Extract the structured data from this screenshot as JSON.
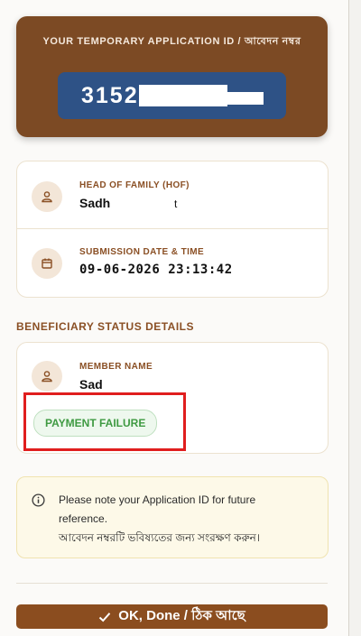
{
  "application": {
    "label": "YOUR TEMPORARY APPLICATION ID  /  আবেদন নম্বর",
    "id_visible": "3152"
  },
  "hof": {
    "label": "HEAD OF FAMILY (HOF)",
    "name_visible": "Sadh",
    "name_trailing": "t",
    "icon": "person-icon"
  },
  "submission": {
    "label": "SUBMISSION DATE & TIME",
    "value": "09-06-2026 23:13:42",
    "icon": "calendar-icon"
  },
  "section": {
    "title": "BENEFICIARY STATUS DETAILS"
  },
  "member": {
    "label": "MEMBER NAME",
    "name_visible": "Sad",
    "icon": "person-icon",
    "status": "PAYMENT FAILURE"
  },
  "note": {
    "line1": "Please note your Application ID for future",
    "line2": "reference.",
    "line3": "আবেদন নম্বরটি ভবিষ্যতের জন্য সংরক্ষণ করুন।",
    "icon": "info-icon"
  },
  "ok_button": {
    "label": "OK, Done / ঠিক আছে",
    "icon": "check-icon"
  },
  "colors": {
    "brand_brown": "#7c4a24",
    "id_blue": "#2e5286",
    "success_green": "#3f9a42",
    "highlight_red": "#e01e1e"
  }
}
